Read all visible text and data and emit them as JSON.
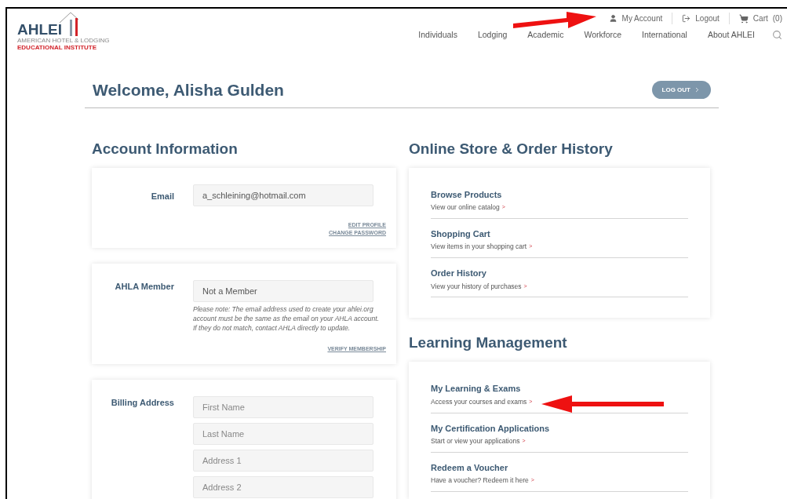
{
  "logo": {
    "name": "AHLEI",
    "tagline_1": "AMERICAN HOTEL & LODGING",
    "tagline_2": "EDUCATIONAL INSTITUTE"
  },
  "utility_links": [
    {
      "kind": "user",
      "label": "My Account"
    },
    {
      "kind": "logout",
      "label": "Logout"
    },
    {
      "kind": "cart",
      "label": "Cart",
      "count": "(0)"
    }
  ],
  "nav": [
    "Individuals",
    "Lodging",
    "Academic",
    "Workforce",
    "International",
    "About AHLEI"
  ],
  "welcome": {
    "title": "Welcome, Alisha Gulden",
    "button": "LOG OUT"
  },
  "account_information": {
    "title": "Account Information",
    "cards": [
      {
        "label": "Email",
        "fields": [
          {
            "value": "a_schleining@hotmail.com"
          }
        ],
        "links": [
          "EDIT PROFILE",
          "CHANGE PASSWORD"
        ]
      },
      {
        "label": "AHLA Member",
        "fields": [
          {
            "value": "Not a Member"
          }
        ],
        "note": "Please note: The email address used to create your ahlei.org account must be the same as the email on your AHLA account. If they do not match, contact AHLA directly to update.",
        "links": [
          "VERIFY MEMBERSHIP"
        ]
      },
      {
        "label": "Billing Address",
        "fields": [
          {
            "placeholder": "First Name"
          },
          {
            "placeholder": "Last Name"
          },
          {
            "placeholder": "Address 1"
          },
          {
            "placeholder": "Address 2"
          }
        ]
      }
    ]
  },
  "online_store": {
    "title": "Online Store & Order History",
    "items": [
      {
        "title": "Browse Products",
        "link": "View our online catalog",
        "arrow": ">"
      },
      {
        "title": "Shopping Cart",
        "link": "View items in your shopping cart",
        "arrow": ">"
      },
      {
        "title": "Order History",
        "link": "View your history of purchases",
        "arrow": ">"
      }
    ]
  },
  "learning_management": {
    "title": "Learning Management",
    "items": [
      {
        "title": "My Learning & Exams",
        "link": "Access your courses and exams",
        "arrow": ">"
      },
      {
        "title": "My Certification Applications",
        "link": "Start or view your applications",
        "arrow": ">"
      },
      {
        "title": "Redeem a Voucher",
        "link": "Have a voucher? Redeem it here",
        "arrow": ">"
      }
    ]
  },
  "annotations": [
    {
      "kind": "arrow"
    },
    {
      "kind": "arrow"
    }
  ]
}
